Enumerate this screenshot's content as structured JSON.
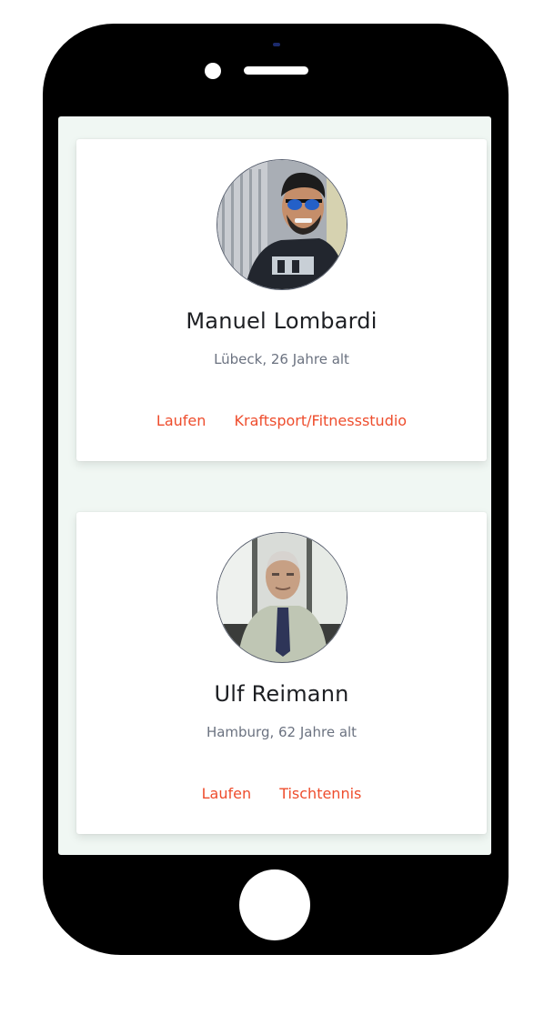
{
  "profiles": [
    {
      "name": "Manuel Lombardi",
      "location_age": "Lübeck, 26 Jahre alt",
      "tags": [
        "Laufen",
        "Kraftsport/Fitnessstudio"
      ]
    },
    {
      "name": "Ulf Reimann",
      "location_age": "Hamburg, 62 Jahre alt",
      "tags": [
        "Laufen",
        "Tischtennis"
      ]
    }
  ],
  "colors": {
    "accent": "#ee4d2d",
    "screen_bg": "#f0f7f3",
    "phone_body": "#000000"
  }
}
